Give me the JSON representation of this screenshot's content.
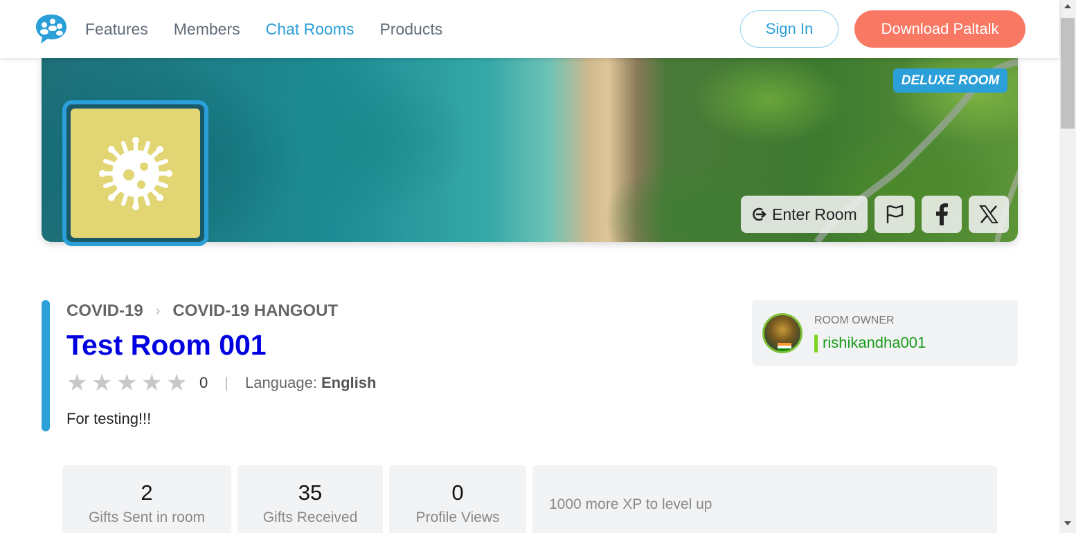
{
  "header": {
    "logo_icon": "paltalk-chat-bubbles-icon",
    "nav": [
      {
        "label": "Features",
        "active": false
      },
      {
        "label": "Members",
        "active": false
      },
      {
        "label": "Chat Rooms",
        "active": true
      },
      {
        "label": "Products",
        "active": false
      }
    ],
    "sign_in_label": "Sign In",
    "download_label": "Download Paltalk"
  },
  "banner": {
    "badge": "DELUXE ROOM",
    "enter_room_label": "Enter Room",
    "enter_icon": "enter-arrow-icon",
    "actions": [
      "flag-icon",
      "facebook-icon",
      "x-icon"
    ],
    "room_icon": "virus-icon"
  },
  "room": {
    "breadcrumb": [
      "COVID-19",
      "COVID-19 HANGOUT"
    ],
    "title": "Test Room 001",
    "rating_stars": 0,
    "rating_count": "0",
    "language_label": "Language:",
    "language_value": "English",
    "description": "For testing!!!"
  },
  "owner": {
    "label": "ROOM OWNER",
    "name": "rishikandha001"
  },
  "stats": [
    {
      "value": "2",
      "label": "Gifts Sent in room"
    },
    {
      "value": "35",
      "label": "Gifts Received"
    },
    {
      "value": "0",
      "label": "Profile Views"
    }
  ],
  "xp": {
    "text": "1000 more XP to level up"
  },
  "colors": {
    "accent": "#2a9fd8",
    "download": "#f97863",
    "title": "#0000e0",
    "owner_name": "#1a9a1a",
    "room_icon_bg": "#e2d574"
  }
}
